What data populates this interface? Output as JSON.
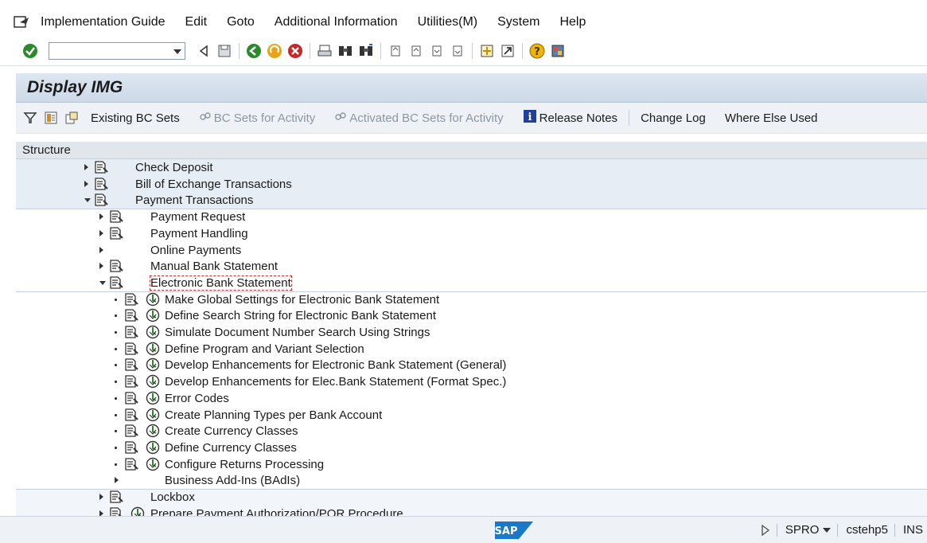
{
  "menubar": {
    "items": [
      "Implementation Guide",
      "Edit",
      "Goto",
      "Additional Information",
      "Utilities(M)",
      "System",
      "Help"
    ]
  },
  "toolbar": {
    "command_field_value": ""
  },
  "title": "Display IMG",
  "app_toolbar": {
    "existing_bc_sets": "Existing BC Sets",
    "bc_sets_for_activity": "BC Sets for Activity",
    "activated_bc_sets": "Activated BC Sets for Activity",
    "release_notes": "Release Notes",
    "change_log": "Change Log",
    "where_else_used": "Where Else Used"
  },
  "structure_header": "Structure",
  "tree": [
    {
      "label": "Check Deposit",
      "level": 0,
      "toggle": "right",
      "doc": true,
      "exe": false
    },
    {
      "label": "Bill of Exchange Transactions",
      "level": 0,
      "toggle": "right",
      "doc": true,
      "exe": false
    },
    {
      "label": "Payment Transactions",
      "level": 0,
      "toggle": "down",
      "doc": true,
      "exe": false
    },
    {
      "label": "Payment Request",
      "level": 1,
      "toggle": "right",
      "doc": true,
      "exe": false
    },
    {
      "label": "Payment Handling",
      "level": 1,
      "toggle": "right",
      "doc": true,
      "exe": false
    },
    {
      "label": "Online Payments",
      "level": 1,
      "toggle": "right",
      "doc": false,
      "exe": false
    },
    {
      "label": "Manual Bank Statement",
      "level": 1,
      "toggle": "right",
      "doc": true,
      "exe": false
    },
    {
      "label": "Electronic Bank Statement",
      "level": 1,
      "toggle": "down",
      "doc": true,
      "exe": false,
      "selected": true
    },
    {
      "label": "Make Global Settings for Electronic Bank Statement",
      "level": 2,
      "toggle": "dot",
      "doc": true,
      "exe": true
    },
    {
      "label": "Define Search String for Electronic Bank Statement",
      "level": 2,
      "toggle": "dot",
      "doc": true,
      "exe": true
    },
    {
      "label": "Simulate Document Number Search Using Strings",
      "level": 2,
      "toggle": "dot",
      "doc": true,
      "exe": true
    },
    {
      "label": "Define Program and Variant Selection",
      "level": 2,
      "toggle": "dot",
      "doc": true,
      "exe": true
    },
    {
      "label": "Develop Enhancements for Electronic Bank Statement (General)",
      "level": 2,
      "toggle": "dot",
      "doc": true,
      "exe": true
    },
    {
      "label": "Develop Enhancements for Elec.Bank Statement (Format Spec.)",
      "level": 2,
      "toggle": "dot",
      "doc": true,
      "exe": true
    },
    {
      "label": "Error Codes",
      "level": 2,
      "toggle": "dot",
      "doc": true,
      "exe": true
    },
    {
      "label": "Create Planning Types per Bank Account",
      "level": 2,
      "toggle": "dot",
      "doc": true,
      "exe": true
    },
    {
      "label": "Create Currency Classes",
      "level": 2,
      "toggle": "dot",
      "doc": true,
      "exe": true
    },
    {
      "label": "Define Currency Classes",
      "level": 2,
      "toggle": "dot",
      "doc": true,
      "exe": true
    },
    {
      "label": "Configure Returns Processing",
      "level": 2,
      "toggle": "dot",
      "doc": true,
      "exe": true
    },
    {
      "label": "Business Add-Ins (BAdIs)",
      "level": 2,
      "toggle": "right",
      "doc": false,
      "exe": false
    },
    {
      "label": "Lockbox",
      "level": 1,
      "toggle": "right",
      "doc": true,
      "exe": false
    },
    {
      "label": "Prepare Payment Authorization/POR Procedure",
      "level": 1,
      "toggle": "right",
      "doc": true,
      "exe": true
    }
  ],
  "status": {
    "transaction": "SPRO",
    "system": "cstehp5",
    "mode": "INS",
    "logo": "SAP"
  }
}
